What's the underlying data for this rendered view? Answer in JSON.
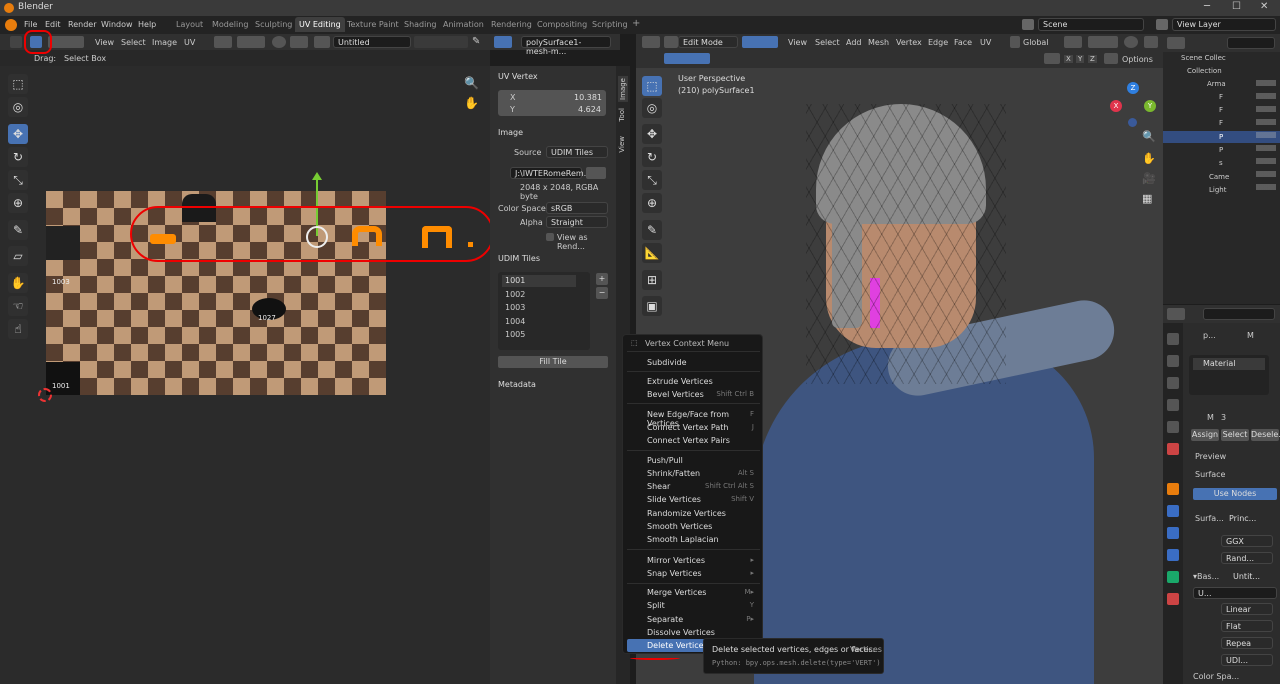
{
  "window": {
    "title": "Blender",
    "minimize": "─",
    "maximize": "☐",
    "close": "✕"
  },
  "menu": {
    "items": [
      "File",
      "Edit",
      "Render",
      "Window",
      "Help"
    ],
    "workspaces": [
      "Layout",
      "Modeling",
      "Sculpting",
      "UV Editing",
      "Texture Paint",
      "Shading",
      "Animation",
      "Rendering",
      "Compositing",
      "Scripting"
    ],
    "add_workspace": "+",
    "scene": "Scene",
    "view_layer": "View Layer"
  },
  "uv_editor": {
    "menus": [
      "View",
      "Select",
      "Image",
      "UV"
    ],
    "image_name": "Untitled",
    "mesh_name": "polySurface1-mesh-m...",
    "drag_label": "Drag:",
    "drag_value": "Select Box",
    "udim_labels": [
      "1003",
      "1027",
      "1001"
    ]
  },
  "npanel": {
    "tabs": [
      "Image",
      "Tool",
      "View"
    ],
    "uv_vertex_title": "UV Vertex",
    "x_label": "X",
    "x_value": "10.381",
    "y_label": "Y",
    "y_value": "4.624",
    "image_title": "Image",
    "source_label": "Source",
    "source_value": "UDIM Tiles",
    "file_path": "J:\\IWTERomeRem...",
    "resolution": "2048 x 2048,  RGBA byte",
    "colorspace_label": "Color Space",
    "colorspace_value": "sRGB",
    "alpha_label": "Alpha",
    "alpha_value": "Straight",
    "view_as_render": "View as Rend...",
    "udim_title": "UDIM Tiles",
    "udim_tiles": [
      "1001",
      "1002",
      "1003",
      "1004",
      "1005"
    ],
    "add_btn": "+",
    "remove_btn": "−",
    "fill_tile": "Fill Tile",
    "metadata_title": "Metadata"
  },
  "viewport": {
    "mode": "Edit Mode",
    "menus": [
      "View",
      "Select",
      "Add",
      "Mesh",
      "Vertex",
      "Edge",
      "Face",
      "UV"
    ],
    "orientation": "Global",
    "perspective": "User Perspective",
    "object_info": "(210) polySurface1",
    "options": "Options",
    "axes": {
      "x": "X",
      "y": "Y",
      "z": "Z"
    }
  },
  "context_menu": {
    "title": "Vertex Context Menu",
    "items": [
      {
        "label": "Subdivide",
        "shortcut": ""
      },
      {
        "label": "Extrude Vertices",
        "shortcut": ""
      },
      {
        "label": "Bevel Vertices",
        "shortcut": "Shift Ctrl B"
      },
      {
        "label": "New Edge/Face from Vertices",
        "shortcut": "F"
      },
      {
        "label": "Connect Vertex Path",
        "shortcut": "J"
      },
      {
        "label": "Connect Vertex Pairs",
        "shortcut": ""
      },
      {
        "label": "Push/Pull",
        "shortcut": ""
      },
      {
        "label": "Shrink/Fatten",
        "shortcut": "Alt S"
      },
      {
        "label": "Shear",
        "shortcut": "Shift Ctrl Alt S"
      },
      {
        "label": "Slide Vertices",
        "shortcut": "Shift V"
      },
      {
        "label": "Randomize Vertices",
        "shortcut": ""
      },
      {
        "label": "Smooth Vertices",
        "shortcut": ""
      },
      {
        "label": "Smooth Laplacian",
        "shortcut": ""
      },
      {
        "label": "Mirror Vertices",
        "shortcut": "▸"
      },
      {
        "label": "Snap Vertices",
        "shortcut": "▸"
      },
      {
        "label": "Merge Vertices",
        "shortcut": "M▸"
      },
      {
        "label": "Split",
        "shortcut": "Y"
      },
      {
        "label": "Separate",
        "shortcut": "P▸"
      },
      {
        "label": "Dissolve Vertices",
        "shortcut": ""
      },
      {
        "label": "Delete Vertices",
        "shortcut": ""
      }
    ],
    "tooltip_text": "Delete selected vertices, edges or faces:",
    "tooltip_tag": "Vertices",
    "tooltip_python": "Python: bpy.ops.mesh.delete(type='VERT')"
  },
  "outliner": {
    "items": [
      "Scene Collec",
      "Collection",
      "Arma",
      "F",
      "F",
      "F",
      "P",
      "P",
      "s",
      "Came",
      "Light"
    ]
  },
  "properties": {
    "obj_short": "p...",
    "mat_short": "M",
    "material_slot": "Material",
    "mat_name": "M",
    "mat_users": "3",
    "assign": "Assign",
    "select": "Select",
    "deselect": "Desele...",
    "preview": "Preview",
    "surface": "Surface",
    "use_nodes": "Use Nodes",
    "surface_label": "Surfa...",
    "surface_value": "Princ...",
    "ggx": "GGX",
    "random": "Rand...",
    "base_label": "▾Bas...",
    "base_value": "Untit...",
    "img_short": "U...",
    "linear": "Linear",
    "flat": "Flat",
    "repeat": "Repea",
    "udim": "UDI...",
    "colorspace_short": "Color Spa..."
  },
  "colors": {
    "accent": "#4772b3",
    "highlight_red": "#e00000",
    "uv_orange": "#ff8c00"
  }
}
